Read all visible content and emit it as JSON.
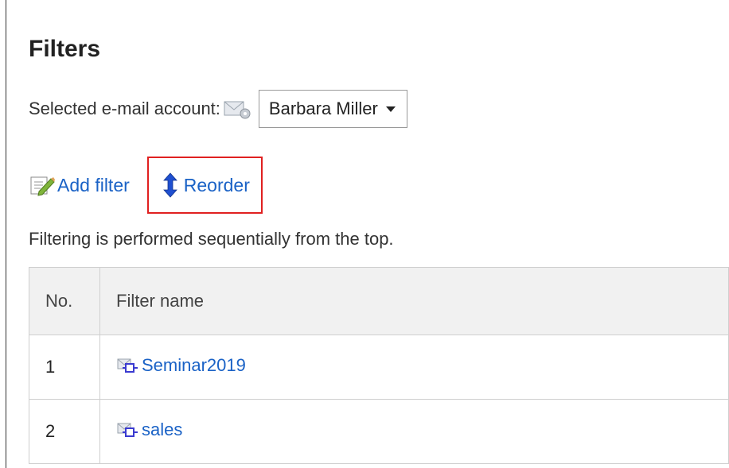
{
  "page": {
    "title": "Filters"
  },
  "account": {
    "label": "Selected e-mail account:",
    "selected": "Barbara Miller"
  },
  "actions": {
    "add_filter": "Add filter",
    "reorder": "Reorder"
  },
  "note": "Filtering is performed sequentially from the top.",
  "table": {
    "headers": {
      "no": "No.",
      "name": "Filter name"
    },
    "rows": [
      {
        "no": "1",
        "name": "Seminar2019"
      },
      {
        "no": "2",
        "name": "sales"
      }
    ]
  },
  "colors": {
    "link": "#1a62c6",
    "highlight_border": "#e02020",
    "header_bg": "#f1f1f1"
  },
  "icons": {
    "account": "mail-settings-icon",
    "add_filter": "edit-note-icon",
    "reorder": "up-down-arrow-icon",
    "filter": "mail-filter-icon"
  }
}
